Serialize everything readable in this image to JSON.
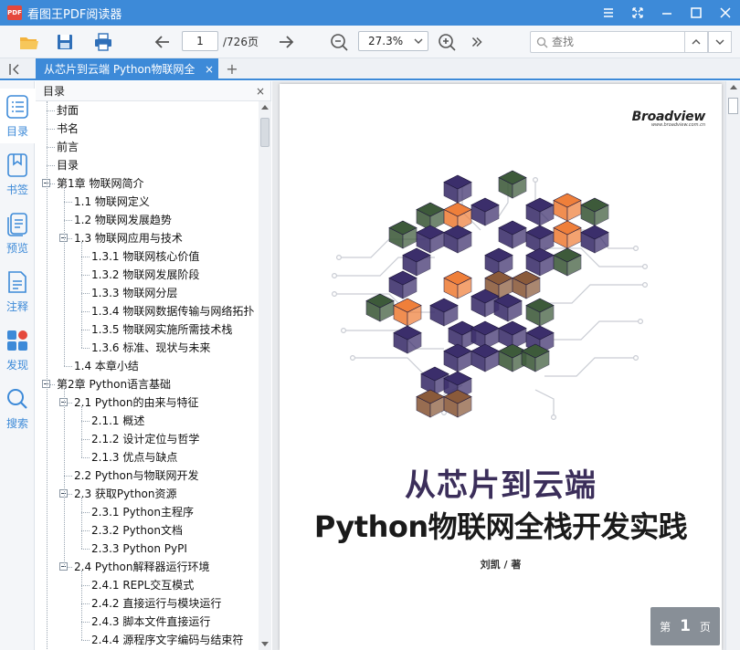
{
  "app": {
    "logo_text": "PDF",
    "title": "看图王PDF阅读器"
  },
  "toolbar": {
    "page_current": "1",
    "page_total": "/726页",
    "zoom": "27.3%",
    "search_placeholder": "查找"
  },
  "tab": {
    "title": "从芯片到云端  Python物联网全",
    "close": "×",
    "new": "+"
  },
  "nav": [
    {
      "label": "目录",
      "icon": "list-icon"
    },
    {
      "label": "书签",
      "icon": "bookmark-icon"
    },
    {
      "label": "预览",
      "icon": "thumbnails-icon"
    },
    {
      "label": "注释",
      "icon": "annotation-icon"
    },
    {
      "label": "发现",
      "icon": "discover-icon"
    },
    {
      "label": "搜索",
      "icon": "search-icon"
    }
  ],
  "toc": {
    "header": "目录",
    "close": "×",
    "items": [
      {
        "label": "封面",
        "level": 0,
        "expand": false
      },
      {
        "label": "书名",
        "level": 0,
        "expand": false
      },
      {
        "label": "前言",
        "level": 0,
        "expand": false
      },
      {
        "label": "目录",
        "level": 0,
        "expand": false
      },
      {
        "label": "第1章 物联网简介",
        "level": 0,
        "expand": true
      },
      {
        "label": "1.1 物联网定义",
        "level": 1,
        "expand": false
      },
      {
        "label": "1.2 物联网发展趋势",
        "level": 1,
        "expand": false
      },
      {
        "label": "1.3 物联网应用与技术",
        "level": 1,
        "expand": true
      },
      {
        "label": "1.3.1 物联网核心价值",
        "level": 2,
        "expand": false
      },
      {
        "label": "1.3.2 物联网发展阶段",
        "level": 2,
        "expand": false
      },
      {
        "label": "1.3.3 物联网分层",
        "level": 2,
        "expand": false
      },
      {
        "label": "1.3.4 物联网数据传输与网络拓扑",
        "level": 2,
        "expand": false
      },
      {
        "label": "1.3.5 物联网实施所需技术栈",
        "level": 2,
        "expand": false
      },
      {
        "label": "1.3.6 标准、现状与未来",
        "level": 2,
        "expand": false
      },
      {
        "label": "1.4 本章小结",
        "level": 1,
        "expand": false
      },
      {
        "label": "第2章 Python语言基础",
        "level": 0,
        "expand": true
      },
      {
        "label": "2.1 Python的由来与特征",
        "level": 1,
        "expand": true
      },
      {
        "label": "2.1.1 概述",
        "level": 2,
        "expand": false
      },
      {
        "label": "2.1.2 设计定位与哲学",
        "level": 2,
        "expand": false
      },
      {
        "label": "2.1.3 优点与缺点",
        "level": 2,
        "expand": false
      },
      {
        "label": "2.2 Python与物联网开发",
        "level": 1,
        "expand": false
      },
      {
        "label": "2.3 获取Python资源",
        "level": 1,
        "expand": true
      },
      {
        "label": "2.3.1 Python主程序",
        "level": 2,
        "expand": false
      },
      {
        "label": "2.3.2 Python文档",
        "level": 2,
        "expand": false
      },
      {
        "label": "2.3.3 Python PyPI",
        "level": 2,
        "expand": false
      },
      {
        "label": "2.4 Python解释器运行环境",
        "level": 1,
        "expand": true
      },
      {
        "label": "2.4.1 REPL交互模式",
        "level": 2,
        "expand": false
      },
      {
        "label": "2.4.2 直接运行与模块运行",
        "level": 2,
        "expand": false
      },
      {
        "label": "2.4.3 脚本文件直接运行",
        "level": 2,
        "expand": false
      },
      {
        "label": "2.4.4 源程序文字编码与结束符",
        "level": 2,
        "expand": false
      }
    ]
  },
  "cover": {
    "publisher": "Broadview",
    "publisher_url": "www.broadview.com.cn",
    "title": "从芯片到云端",
    "subtitle": "Python物联网全栈开发实践",
    "author": "刘凯 / 著"
  },
  "page_indicator": {
    "prefix": "第",
    "number": "1",
    "suffix": "页"
  },
  "colors": {
    "accent": "#3d8ad8",
    "cube_purple": "#3b2e6b",
    "cube_green": "#3d5a3a",
    "cube_orange": "#ef7f3a",
    "cube_brown": "#8a5a3a"
  }
}
